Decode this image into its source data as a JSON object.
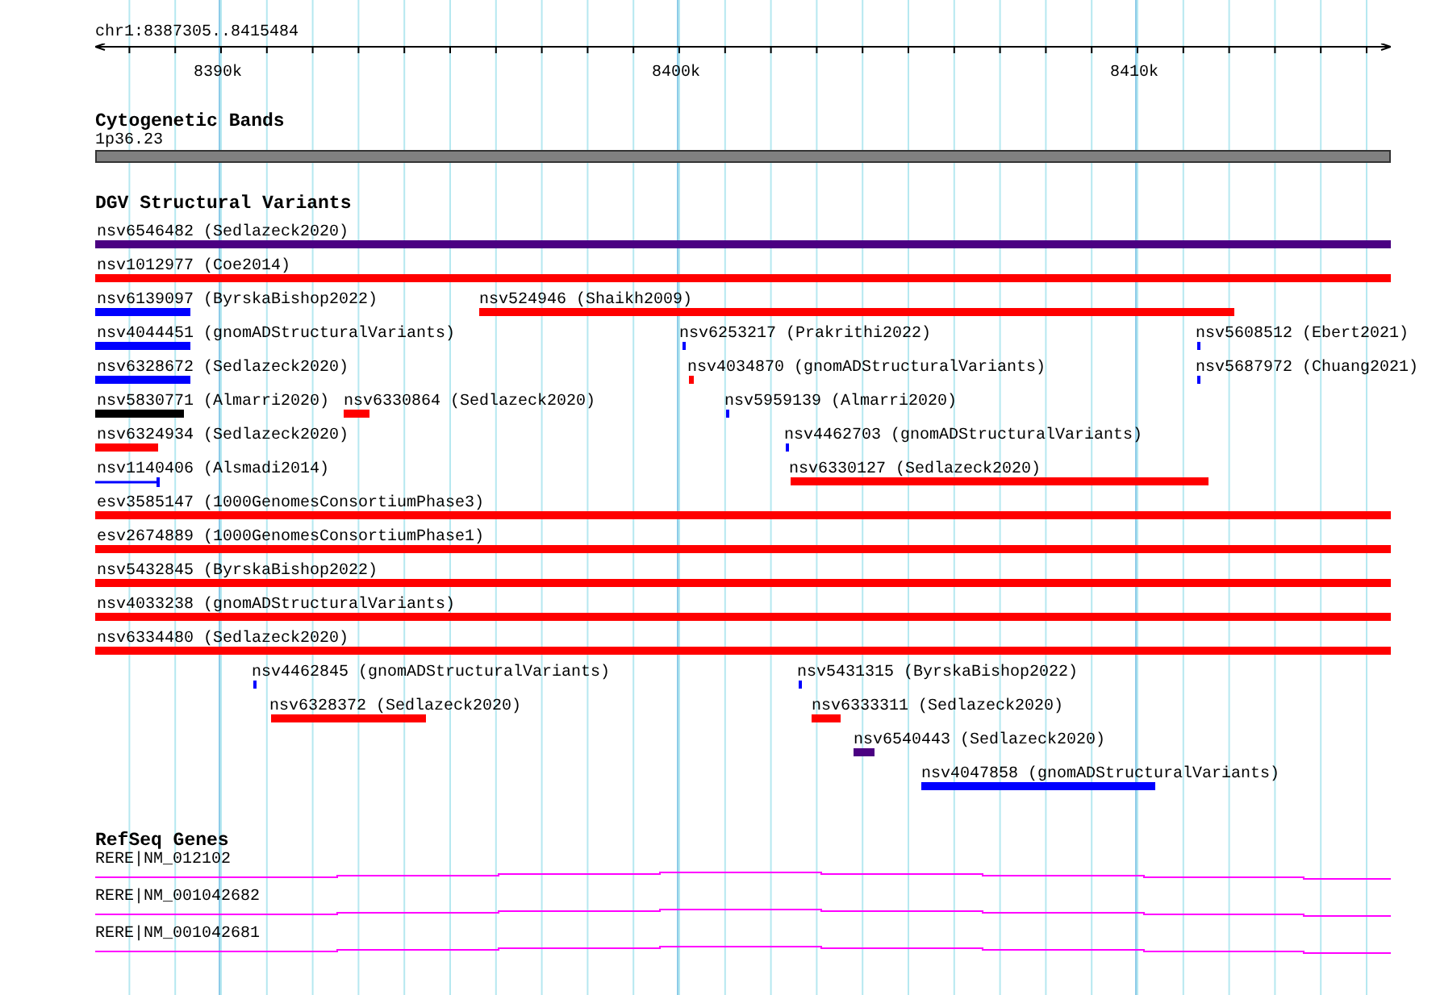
{
  "ruler": {
    "location": "chr1:8387305..8415484",
    "ticks": [
      "8390k",
      "8400k",
      "8410k"
    ]
  },
  "cytobands": {
    "title": "Cytogenetic Bands",
    "band": "1p36.23"
  },
  "dgv": {
    "title": "DGV Structural Variants",
    "variants": [
      {
        "label": "nsv6546482 (Sedlazeck2020)",
        "color": "#4b0082",
        "kind": "bar"
      },
      {
        "label": "nsv1012977 (Coe2014)",
        "color": "#ff0000",
        "kind": "bar"
      },
      {
        "label": "nsv6139097 (ByrskaBishop2022)",
        "color": "#0000ff",
        "kind": "bar"
      },
      {
        "label": "nsv524946 (Shaikh2009)",
        "color": "#ff0000",
        "kind": "bar"
      },
      {
        "label": "nsv4044451 (gnomADStructuralVariants)",
        "color": "#0000ff",
        "kind": "bar"
      },
      {
        "label": "nsv6253217 (Prakrithi2022)",
        "color": "#0000ff",
        "kind": "bar"
      },
      {
        "label": "nsv5608512 (Ebert2021)",
        "color": "#0000ff",
        "kind": "bar"
      },
      {
        "label": "nsv6328672 (Sedlazeck2020)",
        "color": "#0000ff",
        "kind": "bar"
      },
      {
        "label": "nsv4034870 (gnomADStructuralVariants)",
        "color": "#ff0000",
        "kind": "bar"
      },
      {
        "label": "nsv5687972 (Chuang2021)",
        "color": "#0000ff",
        "kind": "bar"
      },
      {
        "label": "nsv5830771 (Almarri2020)",
        "color": "#000000",
        "kind": "bar"
      },
      {
        "label": "nsv6330864 (Sedlazeck2020)",
        "color": "#ff0000",
        "kind": "bar"
      },
      {
        "label": "nsv5959139 (Almarri2020)",
        "color": "#0000ff",
        "kind": "bar"
      },
      {
        "label": "nsv6324934 (Sedlazeck2020)",
        "color": "#ff0000",
        "kind": "bar"
      },
      {
        "label": "nsv4462703 (gnomADStructuralVariants)",
        "color": "#0000ff",
        "kind": "bar"
      },
      {
        "label": "nsv1140406 (Alsmadi2014)",
        "color": "#0000ff",
        "kind": "line"
      },
      {
        "label": "nsv6330127 (Sedlazeck2020)",
        "color": "#ff0000",
        "kind": "bar"
      },
      {
        "label": "esv3585147 (1000GenomesConsortiumPhase3)",
        "color": "#ff0000",
        "kind": "bar"
      },
      {
        "label": "esv2674889 (1000GenomesConsortiumPhase1)",
        "color": "#ff0000",
        "kind": "bar"
      },
      {
        "label": "nsv5432845 (ByrskaBishop2022)",
        "color": "#ff0000",
        "kind": "bar"
      },
      {
        "label": "nsv4033238 (gnomADStructuralVariants)",
        "color": "#ff0000",
        "kind": "bar"
      },
      {
        "label": "nsv6334480 (Sedlazeck2020)",
        "color": "#ff0000",
        "kind": "bar"
      },
      {
        "label": "nsv4462845 (gnomADStructuralVariants)",
        "color": "#0000ff",
        "kind": "bar"
      },
      {
        "label": "nsv5431315 (ByrskaBishop2022)",
        "color": "#0000ff",
        "kind": "bar"
      },
      {
        "label": "nsv6328372 (Sedlazeck2020)",
        "color": "#ff0000",
        "kind": "bar"
      },
      {
        "label": "nsv6333311 (Sedlazeck2020)",
        "color": "#ff0000",
        "kind": "bar"
      },
      {
        "label": "nsv6540443 (Sedlazeck2020)",
        "color": "#4b0082",
        "kind": "bar"
      },
      {
        "label": "nsv4047858 (gnomADStructuralVariants)",
        "color": "#0000ff",
        "kind": "bar"
      }
    ]
  },
  "genes": {
    "title": "RefSeq Genes",
    "transcripts": [
      "RERE|NM_012102",
      "RERE|NM_001042682",
      "RERE|NM_001042681"
    ]
  }
}
